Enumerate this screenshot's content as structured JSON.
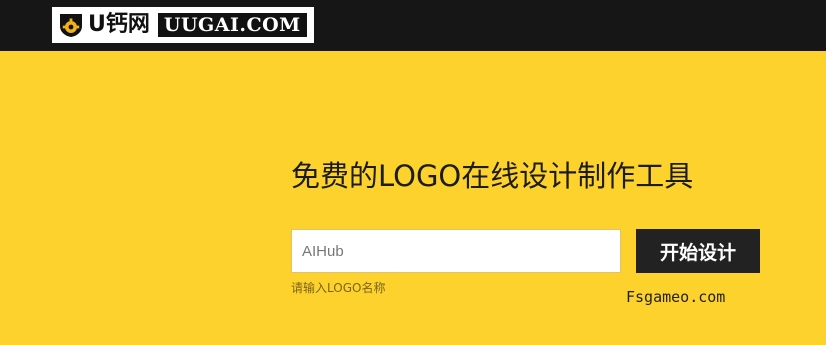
{
  "header": {
    "logo_cn": "U钙网",
    "logo_en": "UUGAI.COM",
    "logo_icon": "shield-gear-icon",
    "background": "#161616"
  },
  "main": {
    "headline": "免费的LOGO在线设计制作工具",
    "input": {
      "value": "AIHub",
      "hint": "请输入LOGO名称"
    },
    "start_button_label": "开始设计",
    "watermark": "Fsgameo.com",
    "background": "#fdd22c",
    "button_color": "#222222"
  }
}
